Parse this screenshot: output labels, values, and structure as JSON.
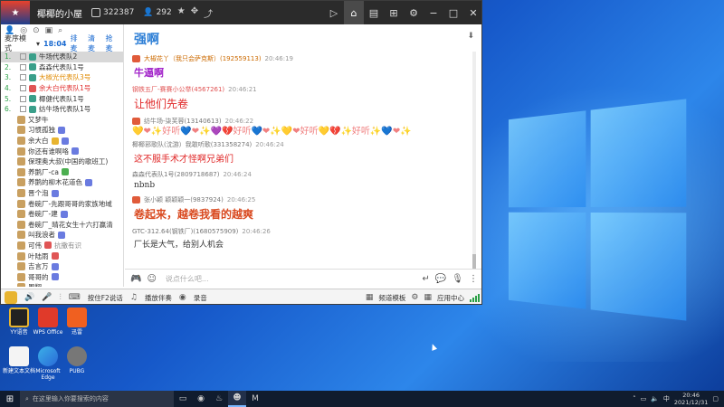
{
  "window": {
    "title": "椰椰的小屋",
    "room_id": "322387",
    "online": "292"
  },
  "left_panel": {
    "mode": "麦序模式",
    "time": "18:04",
    "links": [
      "排麦",
      "清麦",
      "抢麦"
    ],
    "channels": [
      {
        "num": "1.",
        "name": "牛场代表队2"
      },
      {
        "num": "2.",
        "name": "森森代表队1号"
      },
      {
        "num": "3.",
        "name": "大椒光代表队3号"
      },
      {
        "num": "4.",
        "name": "余大白代表队1号"
      },
      {
        "num": "5.",
        "name": "椰健代表队1号"
      },
      {
        "num": "6.",
        "name": "纺牛场代表队1号"
      }
    ],
    "users": [
      "又梦牛",
      "习惯孤独",
      "余大白",
      "你还有谁啊咯",
      "保理奥大叔(中国的歌班工)",
      "养鹅厂-ca",
      "养鹅的柳木花道色",
      "晋个泡",
      "卷碗厂-先跟哥哥的家族地域",
      "卷碗厂-建",
      "卷碗厂_晴花女生十六打赢清",
      "叫我浪者",
      "可伟",
      "叶陆雨",
      "吉言万",
      "哥哥的",
      "周翔"
    ],
    "user_badges": [
      "抗撒有识"
    ]
  },
  "chat": {
    "header": "强啊",
    "messages": [
      {
        "name": "大椒花丫（我只会萨克斯）(192559113)",
        "time": "20:46:19",
        "text": "牛逼啊",
        "style": "purple"
      },
      {
        "name": "钢铁五厂-赛赛小公举(4567261)",
        "time": "20:46:21",
        "text": "让他们先卷",
        "style": "red"
      },
      {
        "name": "纺牛场-柒芙蓉(13140613)",
        "time": "20:46:22",
        "text": "💛❤✨好听💙❤✨💜💔好听💙❤✨💛❤好听💛💔✨好听✨💙❤✨",
        "style": "emoji"
      },
      {
        "name": "椰椰邪歌队(沈游）我敢听歌(331358274)",
        "time": "20:46:24",
        "text": "这不服手术才怪啊兄弟们",
        "style": "red-small"
      },
      {
        "name": "森森代表队1号(2809718687)",
        "time": "20:46:24",
        "text": "nbnb",
        "style": "dark"
      },
      {
        "name": "张小颖 颖颖颖一(9837924)",
        "time": "20:46:25",
        "text": "卷起来，越卷我看的越爽",
        "style": "orange"
      },
      {
        "name": "GTC-312.64(钢铁厂)(1680575909)",
        "time": "20:46:26",
        "text": "厂长是大气，给别人机会",
        "style": "dark"
      }
    ]
  },
  "input": {
    "placeholder": "说点什么吧..."
  },
  "bottom_bar": {
    "ptt_label": "按住F2说话",
    "play_label": "播放伴奏",
    "record_label": "录音",
    "quality_label": "频道模板",
    "apps_label": "应用中心"
  },
  "desktop_icons": [
    {
      "label": "YY语音"
    },
    {
      "label": "WPS Office"
    },
    {
      "label": "迅雷"
    },
    {
      "label": "新建文本文档"
    },
    {
      "label": "Microsoft Edge"
    },
    {
      "label": "PUBG"
    }
  ],
  "taskbar": {
    "search_placeholder": "在这里输入你要搜索的内容",
    "time": "20:46",
    "date": "2021/12/31"
  }
}
